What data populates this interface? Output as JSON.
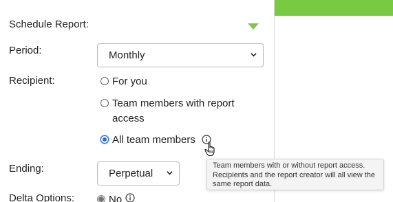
{
  "schedule": {
    "label": "Schedule Report:"
  },
  "period": {
    "label": "Period:",
    "selected": "Monthly"
  },
  "recipient": {
    "label": "Recipient:",
    "options": [
      {
        "label": "For you",
        "checked": false
      },
      {
        "label": "Team members with report access",
        "checked": false
      },
      {
        "label": "All team members",
        "checked": true
      }
    ]
  },
  "tooltip": {
    "text": "Team members with or without report access. Recipients and the report creator will all view the same report data."
  },
  "ending": {
    "label": "Ending:",
    "selected": "Perpetual"
  },
  "delta": {
    "label": "Delta Options:",
    "option": "No"
  },
  "colors": {
    "accent_green": "#7ac943",
    "radio_blue": "#2a6ad8"
  },
  "icons": {
    "expand": "triangle-down-icon",
    "select": "chevron-down-icon",
    "info": "info-icon",
    "cursor": "hand-pointer-icon"
  }
}
